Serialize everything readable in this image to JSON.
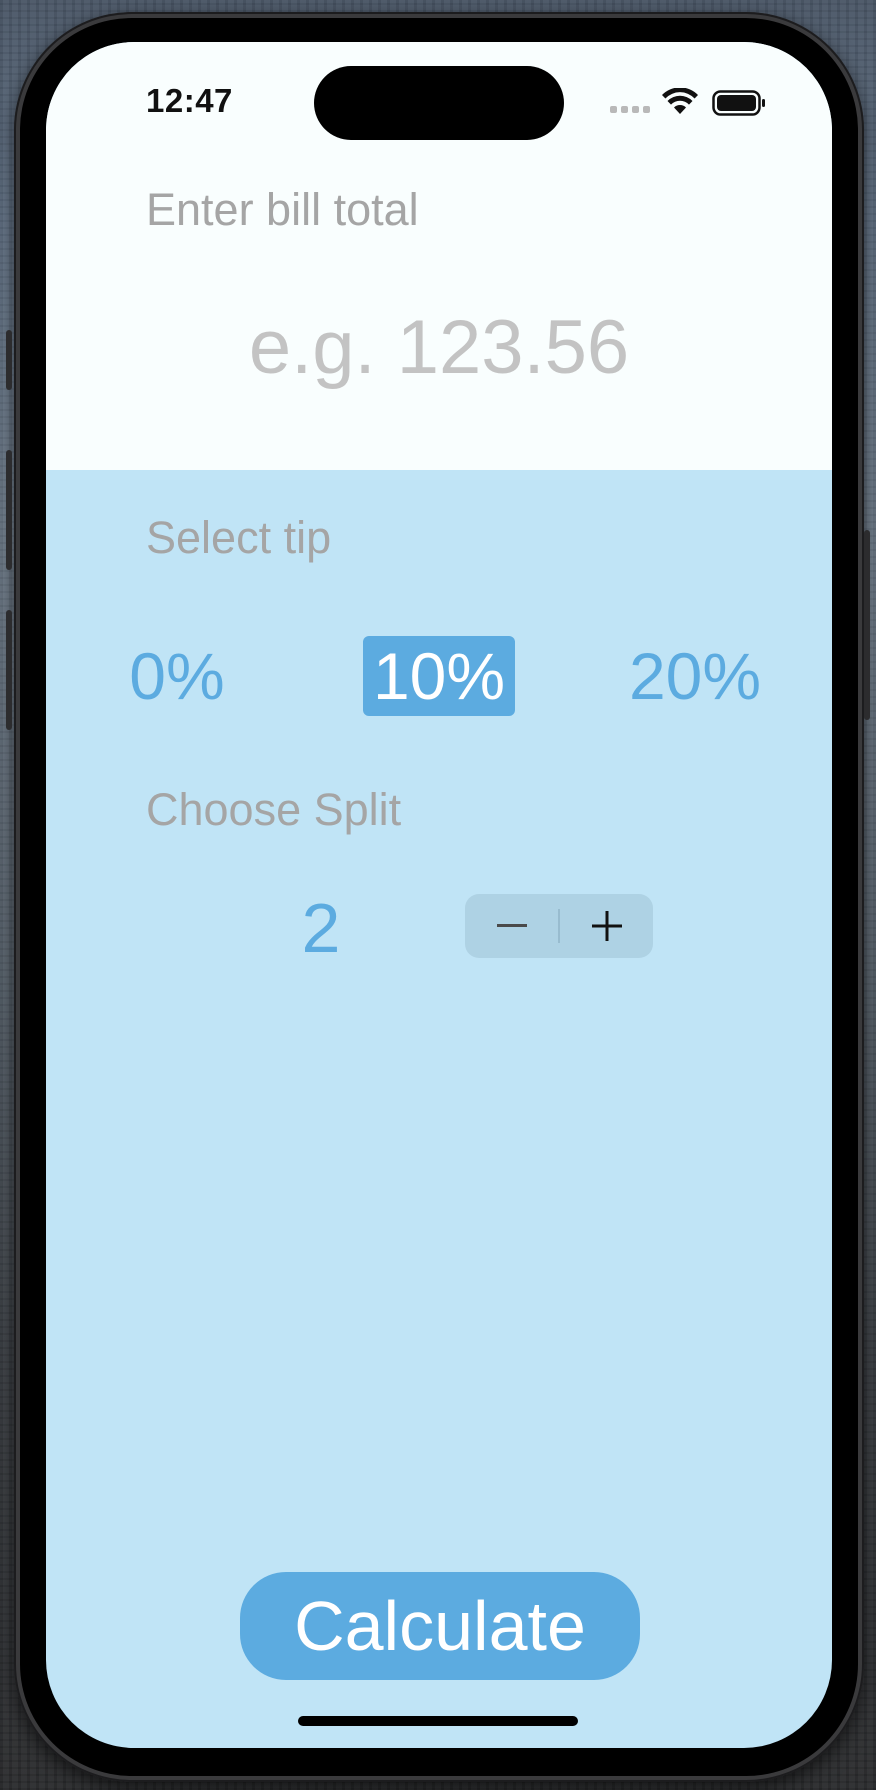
{
  "status_bar": {
    "time": "12:47"
  },
  "bill": {
    "label": "Enter bill total",
    "placeholder": "e.g. 123.56",
    "value": ""
  },
  "tip": {
    "label": "Select tip",
    "options": [
      "0%",
      "10%",
      "20%"
    ],
    "selected": "10%"
  },
  "split": {
    "label": "Choose Split",
    "value": "2",
    "decrement_icon": "minus-icon",
    "increment_icon": "plus-icon"
  },
  "calculate": {
    "label": "Calculate"
  },
  "colors": {
    "accent": "#5cabe0",
    "background_top": "#f9fefe",
    "background_bottom": "#c0e4f6",
    "label_gray": "#a5a5a5"
  }
}
